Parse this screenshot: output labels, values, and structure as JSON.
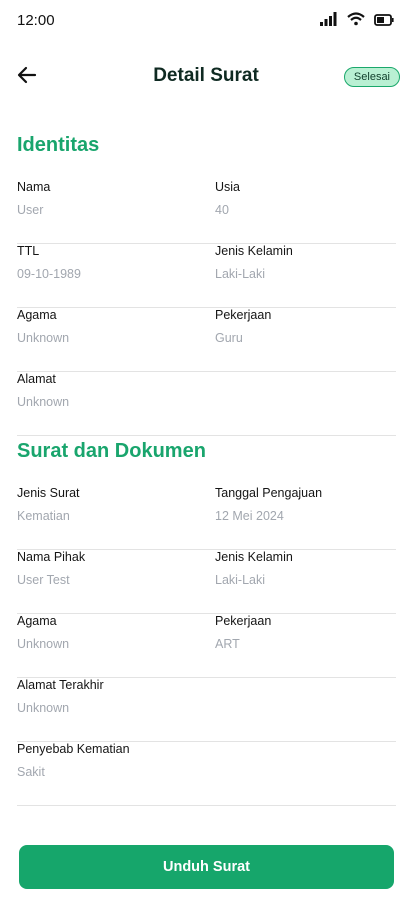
{
  "status_bar": {
    "time": "12:00"
  },
  "header": {
    "title": "Detail Surat",
    "status": "Selesai"
  },
  "identitas": {
    "title": "Identitas",
    "rows": [
      {
        "left": {
          "label": "Nama",
          "value": "User"
        },
        "right": {
          "label": "Usia",
          "value": "40"
        }
      },
      {
        "left": {
          "label": "TTL",
          "value": "09-10-1989"
        },
        "right": {
          "label": "Jenis Kelamin",
          "value": "Laki-Laki"
        }
      },
      {
        "left": {
          "label": "Agama",
          "value": "Unknown"
        },
        "right": {
          "label": "Pekerjaan",
          "value": "Guru"
        }
      },
      {
        "left": {
          "label": "Alamat",
          "value": "Unknown"
        }
      }
    ]
  },
  "dokumen": {
    "title": "Surat dan Dokumen",
    "rows": [
      {
        "left": {
          "label": "Jenis Surat",
          "value": "Kematian"
        },
        "right": {
          "label": "Tanggal Pengajuan",
          "value": "12 Mei 2024"
        }
      },
      {
        "left": {
          "label": "Nama Pihak",
          "value": "User Test"
        },
        "right": {
          "label": "Jenis Kelamin",
          "value": "Laki-Laki"
        }
      },
      {
        "left": {
          "label": "Agama",
          "value": "Unknown"
        },
        "right": {
          "label": "Pekerjaan",
          "value": "ART"
        }
      },
      {
        "left": {
          "label": "Alamat Terakhir",
          "value": "Unknown"
        }
      },
      {
        "left": {
          "label": "Penyebab Kematian",
          "value": "Sakit"
        }
      }
    ]
  },
  "actions": {
    "download_label": "Unduh Surat"
  },
  "colors": {
    "accent": "#16a66b",
    "badge_bg": "#b9f0d3",
    "muted": "#a2a7af"
  }
}
